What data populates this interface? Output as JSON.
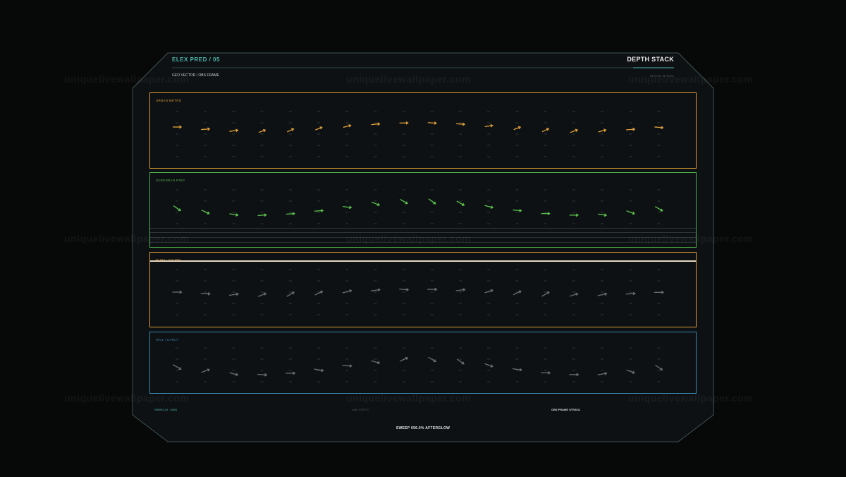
{
  "header": {
    "title": "ELEX PRED / 05",
    "right_title": "DEPTH STACK",
    "subtitle": "GEO VECTOR / OBS FRAME",
    "sub_right": "REGION / STRATA"
  },
  "panels": [
    {
      "label": "URBAN METRO",
      "color": "#d99a33",
      "vector_color": "#e0a03a",
      "vectors": [
        {
          "angle": 0,
          "len": 12
        },
        {
          "angle": -4,
          "len": 12
        },
        {
          "angle": -8,
          "len": 12
        },
        {
          "angle": -20,
          "len": 10
        },
        {
          "angle": -25,
          "len": 10
        },
        {
          "angle": -22,
          "len": 10
        },
        {
          "angle": -15,
          "len": 11
        },
        {
          "angle": -5,
          "len": 12
        },
        {
          "angle": 0,
          "len": 12
        },
        {
          "angle": 4,
          "len": 12
        },
        {
          "angle": 4,
          "len": 12
        },
        {
          "angle": -8,
          "len": 11
        },
        {
          "angle": -20,
          "len": 10
        },
        {
          "angle": -25,
          "len": 10
        },
        {
          "angle": -20,
          "len": 11
        },
        {
          "angle": -15,
          "len": 11
        },
        {
          "angle": -4,
          "len": 12
        },
        {
          "angle": 5,
          "len": 12
        }
      ]
    },
    {
      "label": "SUBURBAN RING",
      "color": "#4fae4a",
      "vector_color": "#5cc44c",
      "vectors": [
        {
          "angle": 35,
          "len": 12
        },
        {
          "angle": 25,
          "len": 12
        },
        {
          "angle": 10,
          "len": 12
        },
        {
          "angle": -4,
          "len": 12
        },
        {
          "angle": -4,
          "len": 12
        },
        {
          "angle": -4,
          "len": 12
        },
        {
          "angle": 8,
          "len": 12
        },
        {
          "angle": 20,
          "len": 12
        },
        {
          "angle": 30,
          "len": 12
        },
        {
          "angle": 35,
          "len": 12
        },
        {
          "angle": 30,
          "len": 12
        },
        {
          "angle": 15,
          "len": 12
        },
        {
          "angle": 5,
          "len": 12
        },
        {
          "angle": 0,
          "len": 12
        },
        {
          "angle": 0,
          "len": 12
        },
        {
          "angle": 8,
          "len": 12
        },
        {
          "angle": 20,
          "len": 12
        },
        {
          "angle": 30,
          "len": 12
        }
      ]
    },
    {
      "label": "RURAL EXURB",
      "color": "#d99a33",
      "vector_color": "#6a6e6e",
      "vectors": [
        {
          "angle": 0,
          "len": 13
        },
        {
          "angle": 4,
          "len": 13
        },
        {
          "angle": -8,
          "len": 13
        },
        {
          "angle": -22,
          "len": 12
        },
        {
          "angle": -30,
          "len": 12
        },
        {
          "angle": -25,
          "len": 12
        },
        {
          "angle": -15,
          "len": 13
        },
        {
          "angle": -8,
          "len": 13
        },
        {
          "angle": 4,
          "len": 13
        },
        {
          "angle": 0,
          "len": 13
        },
        {
          "angle": -8,
          "len": 13
        },
        {
          "angle": -18,
          "len": 12
        },
        {
          "angle": -25,
          "len": 12
        },
        {
          "angle": -30,
          "len": 12
        },
        {
          "angle": -18,
          "len": 12
        },
        {
          "angle": -12,
          "len": 13
        },
        {
          "angle": -4,
          "len": 13
        },
        {
          "angle": 0,
          "len": 13
        }
      ]
    },
    {
      "label": "MAIL / EARLY",
      "color": "#3d86b0",
      "vector_color": "#6a6e6e",
      "vectors": [
        {
          "angle": 30,
          "len": 13
        },
        {
          "angle": -20,
          "len": 12
        },
        {
          "angle": 15,
          "len": 12
        },
        {
          "angle": 4,
          "len": 13
        },
        {
          "angle": 0,
          "len": 13
        },
        {
          "angle": 10,
          "len": 13
        },
        {
          "angle": 4,
          "len": 13
        },
        {
          "angle": 15,
          "len": 12
        },
        {
          "angle": -25,
          "len": 12
        },
        {
          "angle": 30,
          "len": 12
        },
        {
          "angle": 35,
          "len": 12
        },
        {
          "angle": 20,
          "len": 12
        },
        {
          "angle": 8,
          "len": 13
        },
        {
          "angle": 0,
          "len": 13
        },
        {
          "angle": 0,
          "len": 13
        },
        {
          "angle": -10,
          "len": 13
        },
        {
          "angle": 20,
          "len": 12
        },
        {
          "angle": 35,
          "len": 12
        }
      ]
    }
  ],
  "footer": {
    "left": "SWING AZ · BIAS",
    "center": "LINE STEP 5",
    "right": "OBS FRAME STRATA",
    "sweep": "SWEEP 056.0% AFTERGLOW"
  },
  "colors": {
    "frame_stroke": "#3f5452",
    "panel_bg": "#0d1113",
    "accent_teal": "#4fb5a8"
  },
  "watermark": "uniquelivewallpaper.com"
}
